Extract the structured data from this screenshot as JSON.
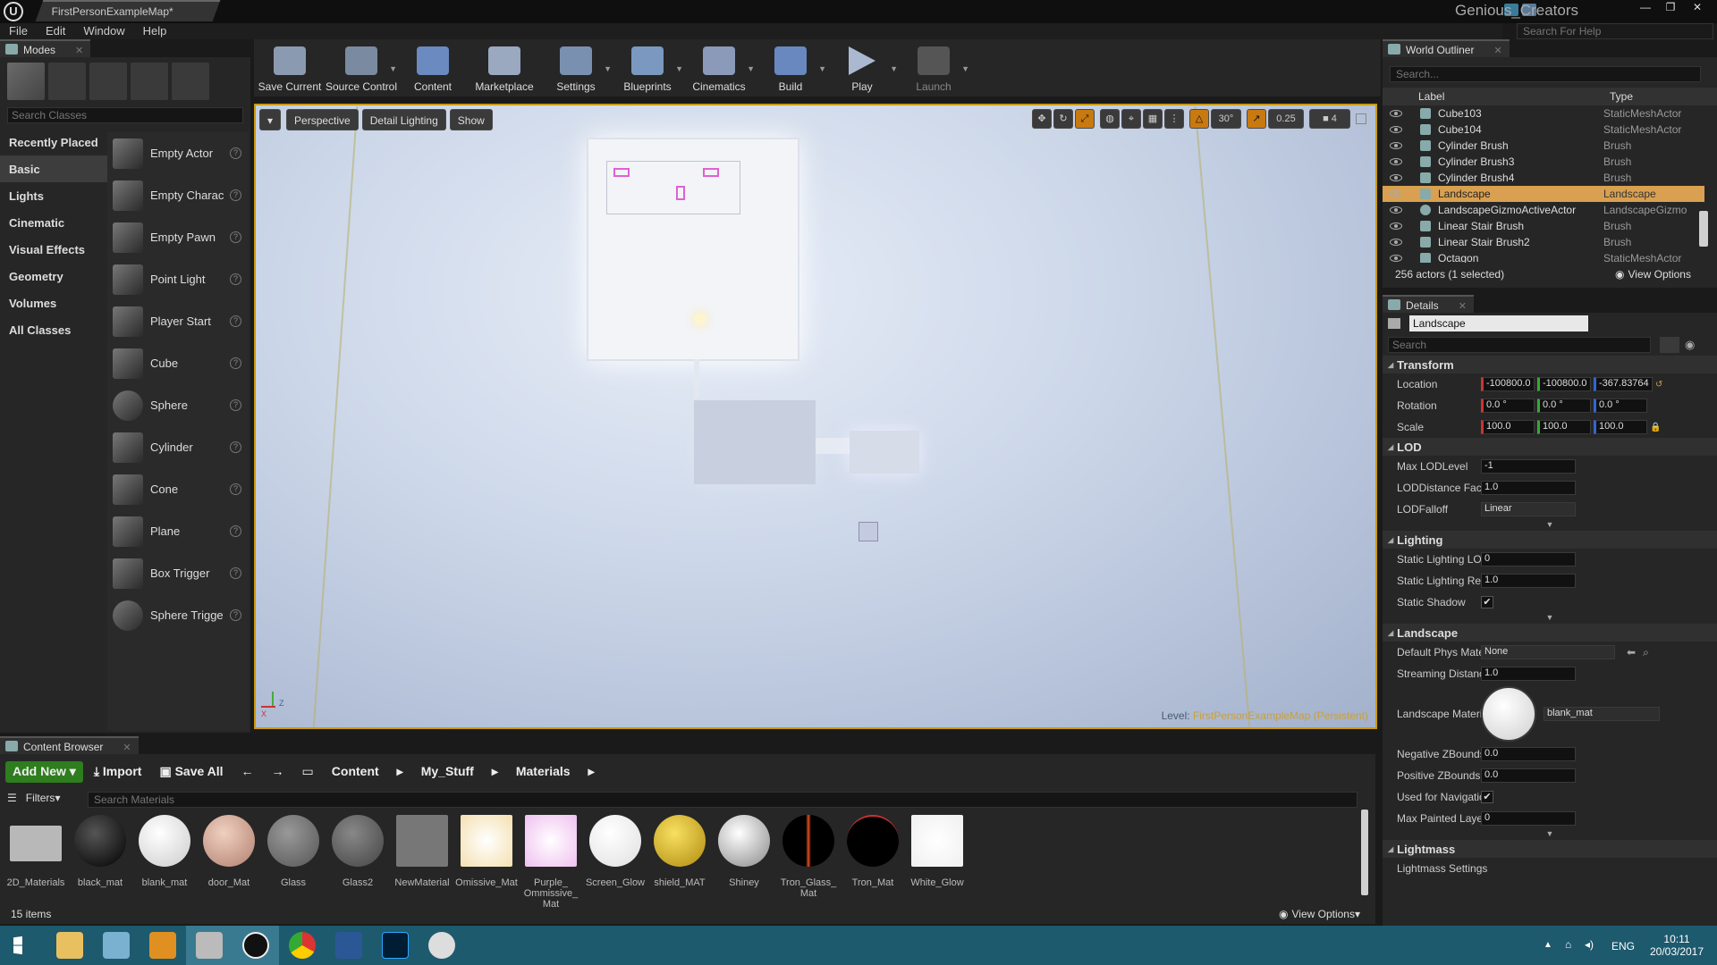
{
  "titlebar": {
    "doc_tab": "FirstPersonExampleMap*",
    "username": "Genious_Creators",
    "help_search_placeholder": "Search For Help",
    "min": "—",
    "max": "❐",
    "close": "✕",
    "logo": "U"
  },
  "menu": [
    "File",
    "Edit",
    "Window",
    "Help"
  ],
  "modes": {
    "tab_label": "Modes",
    "search_placeholder": "Search Classes",
    "categories": [
      "Recently Placed",
      "Basic",
      "Lights",
      "Cinematic",
      "Visual Effects",
      "Geometry",
      "Volumes",
      "All Classes"
    ],
    "selected_category": "Basic",
    "items": [
      "Empty Actor",
      "Empty Charac",
      "Empty Pawn",
      "Point Light",
      "Player Start",
      "Cube",
      "Sphere",
      "Cylinder",
      "Cone",
      "Plane",
      "Box Trigger",
      "Sphere Trigge"
    ],
    "help_glyph": "?"
  },
  "toolbar": {
    "buttons": [
      "Save Current",
      "Source Control",
      "Content",
      "Marketplace",
      "Settings",
      "Blueprints",
      "Cinematics",
      "Build",
      "Play",
      "Launch"
    ]
  },
  "viewport": {
    "menu_arrow": "▾",
    "perspective": "Perspective",
    "lighting": "Detail Lighting",
    "show": "Show",
    "rotation_snap": "30°",
    "scale_snap": "0.25",
    "camera_speed": "4",
    "level_prefix": "Level:",
    "level_name": "FirstPersonExampleMap (Persistent)",
    "axis_z": "Z",
    "axis_x": "X"
  },
  "outliner": {
    "tab_label": "World Outliner",
    "search_placeholder": "Search...",
    "col_label": "Label",
    "col_type": "Type",
    "rows": [
      {
        "label": "Cube103",
        "type": "StaticMeshActor"
      },
      {
        "label": "Cube104",
        "type": "StaticMeshActor"
      },
      {
        "label": "Cylinder Brush",
        "type": "Brush"
      },
      {
        "label": "Cylinder Brush3",
        "type": "Brush"
      },
      {
        "label": "Cylinder Brush4",
        "type": "Brush"
      },
      {
        "label": "Landscape",
        "type": "Landscape"
      },
      {
        "label": "LandscapeGizmoActiveActor",
        "type": "LandscapeGizmo"
      },
      {
        "label": "Linear Stair Brush",
        "type": "Brush"
      },
      {
        "label": "Linear Stair Brush2",
        "type": "Brush"
      },
      {
        "label": "Octagon",
        "type": "StaticMeshActor"
      }
    ],
    "selected_index": 5,
    "footer": "256 actors (1 selected)",
    "view_options": "View Options"
  },
  "details": {
    "tab_label": "Details",
    "object_name": "Landscape",
    "search_placeholder": "Search",
    "transform": {
      "title": "Transform",
      "location_label": "Location",
      "location": [
        "-100800.0",
        "-100800.0",
        "-367.83764"
      ],
      "rotation_label": "Rotation",
      "rotation": [
        "0.0 °",
        "0.0 °",
        "0.0 °"
      ],
      "scale_label": "Scale",
      "scale": [
        "100.0",
        "100.0",
        "100.0"
      ]
    },
    "lod": {
      "title": "LOD",
      "rows": [
        {
          "label": "Max LODLevel",
          "value": "-1"
        },
        {
          "label": "LODDistance Factor",
          "value": "1.0"
        },
        {
          "label": "LODFalloff",
          "value": "Linear"
        }
      ]
    },
    "lighting": {
      "title": "Lighting",
      "rows": [
        {
          "label": "Static Lighting LOD",
          "value": "0"
        },
        {
          "label": "Static Lighting Resol",
          "value": "1.0"
        }
      ],
      "shadow_label": "Static Shadow",
      "shadow_checked": true
    },
    "landscape": {
      "title": "Landscape",
      "phys_label": "Default Phys Materia",
      "phys_value": "None",
      "stream_label": "Streaming Distance M",
      "stream_value": "1.0",
      "material_label": "Landscape Material",
      "material_value": "blank_mat",
      "neg_label": "Negative ZBounds Ex",
      "neg_value": "0.0",
      "pos_label": "Positive ZBounds Ext",
      "pos_value": "0.0",
      "nav_label": "Used for Navigation",
      "nav_checked": true,
      "painted_label": "Max Painted Layers I",
      "painted_value": "0"
    },
    "lightmass": {
      "title": "Lightmass",
      "sub": "Lightmass Settings"
    }
  },
  "content_browser": {
    "tab_label": "Content Browser",
    "add_new": "Add New",
    "import": "Import",
    "save_all": "Save All",
    "path": [
      "Content",
      "My_Stuff",
      "Materials"
    ],
    "filters": "Filters",
    "search_placeholder": "Search Materials",
    "assets": [
      "2D_Materials",
      "black_mat",
      "blank_mat",
      "door_Mat",
      "Glass",
      "Glass2",
      "NewMaterial",
      "Omissive_Mat",
      "Purple_ Ommissive_ Mat",
      "Screen_Glow",
      "shield_MAT",
      "Shiney",
      "Tron_Glass_ Mat",
      "Tron_Mat",
      "White_Glow"
    ],
    "item_count": "15 items",
    "view_options": "View Options"
  },
  "taskbar": {
    "lang": "ENG",
    "time": "10:11",
    "date": "20/03/2017"
  }
}
